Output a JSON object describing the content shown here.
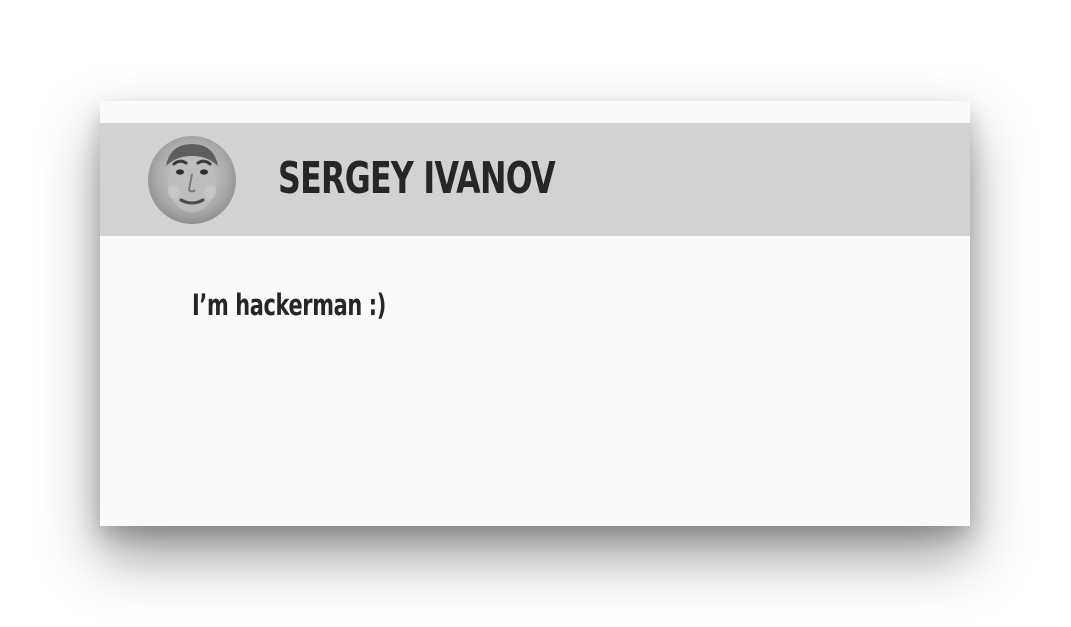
{
  "profile": {
    "name": "SERGEY IVANOV",
    "status": "I’m hackerman :)",
    "avatar_icon": "person-photo-avatar"
  },
  "colors": {
    "card_background": "#f9fafa",
    "header_background": "#d1d2d3",
    "text": "#262626"
  }
}
